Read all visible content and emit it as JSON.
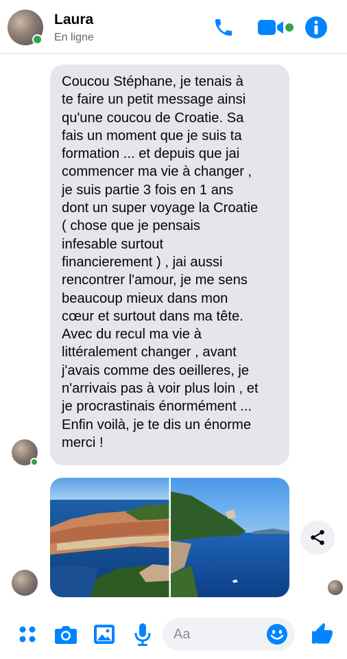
{
  "header": {
    "contact_name": "Laura",
    "status": "En ligne",
    "call_icon": "phone-icon",
    "video_icon": "video-camera-icon",
    "info_icon": "info-icon"
  },
  "message": {
    "lines": [
      "Coucou Stéphane,  je tenais à",
      "te faire un petit message ainsi",
      "qu'une coucou de Croatie.  Sa",
      "fais un moment que je suis ta",
      "formation ... et depuis que jai",
      "commencer ma vie à changer ,",
      "je suis partie 3 fois en 1 ans",
      "dont un super voyage la Croatie",
      "( chose que je pensais",
      "infesable surtout",
      "financierement ) , jai aussi",
      "rencontrer l'amour,  je me sens",
      "beaucoup mieux dans mon",
      "cœur et surtout dans ma tête.",
      "Avec du recul ma vie à",
      "littéralement changer , avant",
      "j'avais comme des oeilleres,  je",
      "n'arrivais pas à voir plus loin , et",
      "je procrastinais énormément ...",
      "Enfin voilà,  je te dis un énorme",
      "merci !"
    ]
  },
  "photos": [
    {
      "name": "dubrovnik-old-town-photo"
    },
    {
      "name": "coastline-photo"
    }
  ],
  "composer": {
    "placeholder": "Aa",
    "icons": [
      "menu-dots-icon",
      "camera-icon",
      "gallery-icon",
      "microphone-icon",
      "emoji-icon",
      "thumbs-up-icon"
    ]
  },
  "colors": {
    "accent": "#0084ff",
    "online": "#31a24c",
    "bubble": "#e4e6eb",
    "muted_text": "#65676b"
  }
}
